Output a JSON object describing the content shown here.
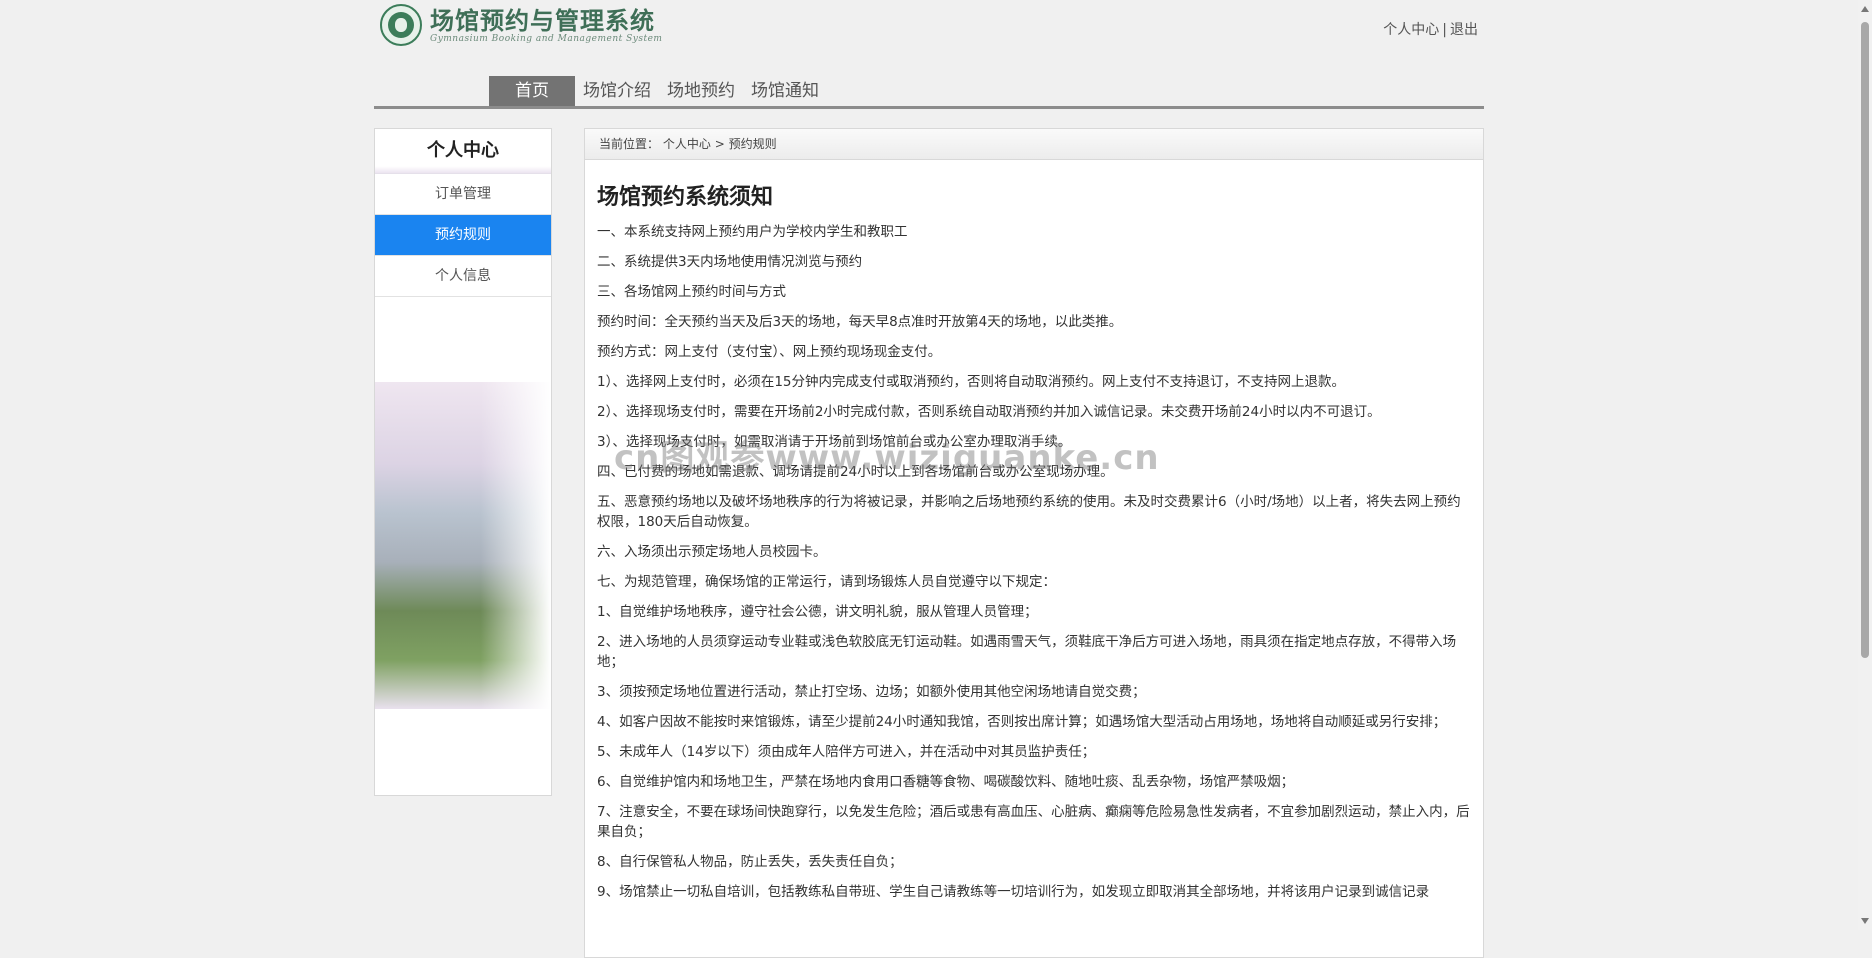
{
  "header": {
    "title": "场馆预约与管理系统",
    "subtitle": "Gymnasium Booking and Management System",
    "user_center": "个人中心",
    "separator": "|",
    "logout": "退出"
  },
  "nav": {
    "items": [
      "首页",
      "场馆介绍",
      "场地预约",
      "场馆通知"
    ],
    "active_index": 0
  },
  "sidebar": {
    "title": "个人中心",
    "items": [
      "订单管理",
      "预约规则",
      "个人信息"
    ],
    "active_index": 1
  },
  "breadcrumb": {
    "prefix": "当前位置：",
    "level1": "个人中心",
    "arrow": ">",
    "level2": "预约规则"
  },
  "rules": {
    "title": "场馆预约系统须知",
    "lines": [
      "一、本系统支持网上预约用户为学校内学生和教职工",
      "二、系统提供3天内场地使用情况浏览与预约",
      "三、各场馆网上预约时间与方式",
      "预约时间：全天预约当天及后3天的场地，每天早8点准时开放第4天的场地，以此类推。",
      "预约方式：网上支付（支付宝）、网上预约现场现金支付。",
      "1）、选择网上支付时，必须在15分钟内完成支付或取消预约，否则将自动取消预约。网上支付不支持退订，不支持网上退款。",
      "2）、选择现场支付时，需要在开场前2小时完成付款，否则系统自动取消预约并加入诚信记录。未交费开场前24小时以内不可退订。",
      "3）、选择现场支付时，如需取消请于开场前到场馆前台或办公室办理取消手续。",
      "四、已付费的场地如需退款、调场请提前24小时以上到各场馆前台或办公室现场办理。",
      "五、恶意预约场地以及破坏场地秩序的行为将被记录，并影响之后场地预约系统的使用。未及时交费累计6（小时/场地）以上者，将失去网上预约权限，180天后自动恢复。",
      "六、入场须出示预定场地人员校园卡。",
      "七、为规范管理，确保场馆的正常运行，请到场锻炼人员自觉遵守以下规定：",
      "1、自觉维护场地秩序，遵守社会公德，讲文明礼貌，服从管理人员管理；",
      "2、进入场地的人员须穿运动专业鞋或浅色软胶底无钉运动鞋。如遇雨雪天气，须鞋底干净后方可进入场地，雨具须在指定地点存放，不得带入场地；",
      "3、须按预定场地位置进行活动，禁止打空场、边场；如额外使用其他空闲场地请自觉交费；",
      "4、如客户因故不能按时来馆锻炼，请至少提前24小时通知我馆，否则按出席计算；如遇场馆大型活动占用场地，场地将自动顺延或另行安排；",
      "5、未成年人（14岁以下）须由成年人陪伴方可进入，并在活动中对其员监护责任；",
      "6、自觉维护馆内和场地卫生，严禁在场地内食用口香糖等食物、喝碳酸饮料、随地吐痰、乱丢杂物，场馆严禁吸烟；",
      "7、注意安全，不要在球场间快跑穿行，以免发生危险；酒后或患有高血压、心脏病、癫痫等危险易急性发病者，不宜参加剧烈运动，禁止入内，后果自负；",
      "8、自行保管私人物品，防止丢失，丢失责任自负；",
      "9、场馆禁止一切私自培训，包括教练私自带班、学生自己请教练等一切培训行为，如发现立即取消其全部场地，并将该用户记录到诚信记录"
    ]
  },
  "watermark": "cn图观参www.wiziguanke.cn",
  "colors": {
    "logo_green": "#3f6f57",
    "nav_active_bg": "#737373",
    "sidebar_active_bg": "#1a84f0"
  }
}
